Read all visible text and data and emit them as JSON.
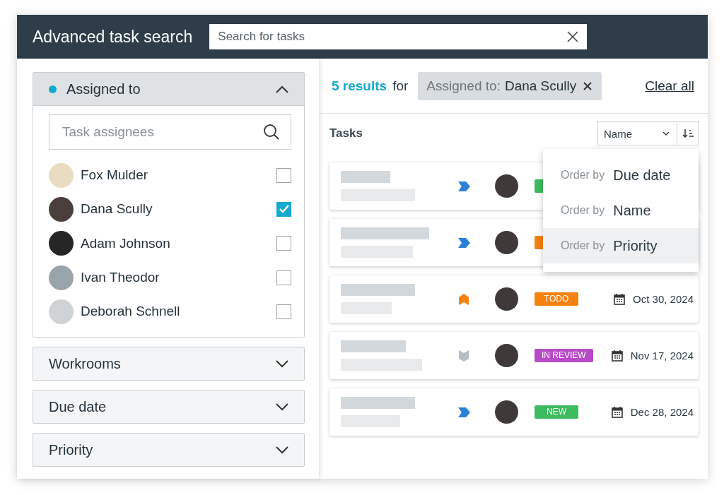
{
  "header": {
    "title": "Advanced task search",
    "search": {
      "placeholder": "Search for tasks"
    }
  },
  "filters": [
    {
      "label": "Assigned to",
      "active": true,
      "expanded": true,
      "search": {
        "placeholder": "Task assignees"
      },
      "options": [
        {
          "name": "Fox Mulder",
          "checked": false
        },
        {
          "name": "Dana Scully",
          "checked": true
        },
        {
          "name": "Adam Johnson",
          "checked": false
        },
        {
          "name": "Ivan Theodor",
          "checked": false
        },
        {
          "name": "Deborah Schnell",
          "checked": false
        }
      ]
    },
    {
      "label": "Workrooms",
      "active": false,
      "expanded": false
    },
    {
      "label": "Due date",
      "active": false,
      "expanded": false
    },
    {
      "label": "Priority",
      "active": false,
      "expanded": false
    }
  ],
  "results": {
    "count": "5 results",
    "suffix": "for",
    "chip": {
      "key": "Assigned to:",
      "value": "Dana Scully"
    },
    "clear": "Clear all"
  },
  "tasks_title": "Tasks",
  "sort": {
    "value": "Name",
    "menu": [
      {
        "prefix": "Order by",
        "label": "Due date",
        "highlighted": false
      },
      {
        "prefix": "Order by",
        "label": "Name",
        "highlighted": false
      },
      {
        "prefix": "Order by",
        "label": "Priority",
        "highlighted": true
      }
    ]
  },
  "tasks": [
    {
      "kind": "normal",
      "status": {
        "color": "#3dbb5e"
      }
    },
    {
      "kind": "normal",
      "status": {
        "color": "#f5820d"
      }
    },
    {
      "kind": "high",
      "status": {
        "label": "TODO",
        "color": "#f5820d"
      },
      "date": "Oct 30, 2024"
    },
    {
      "kind": "low",
      "status": {
        "label": "IN REVIEW",
        "color": "#b84ac9"
      },
      "date": "Nov 17, 2024"
    },
    {
      "kind": "normal",
      "status": {
        "label": "NEW",
        "color": "#3dbb5e"
      },
      "date": "Dec 28, 2024"
    }
  ]
}
